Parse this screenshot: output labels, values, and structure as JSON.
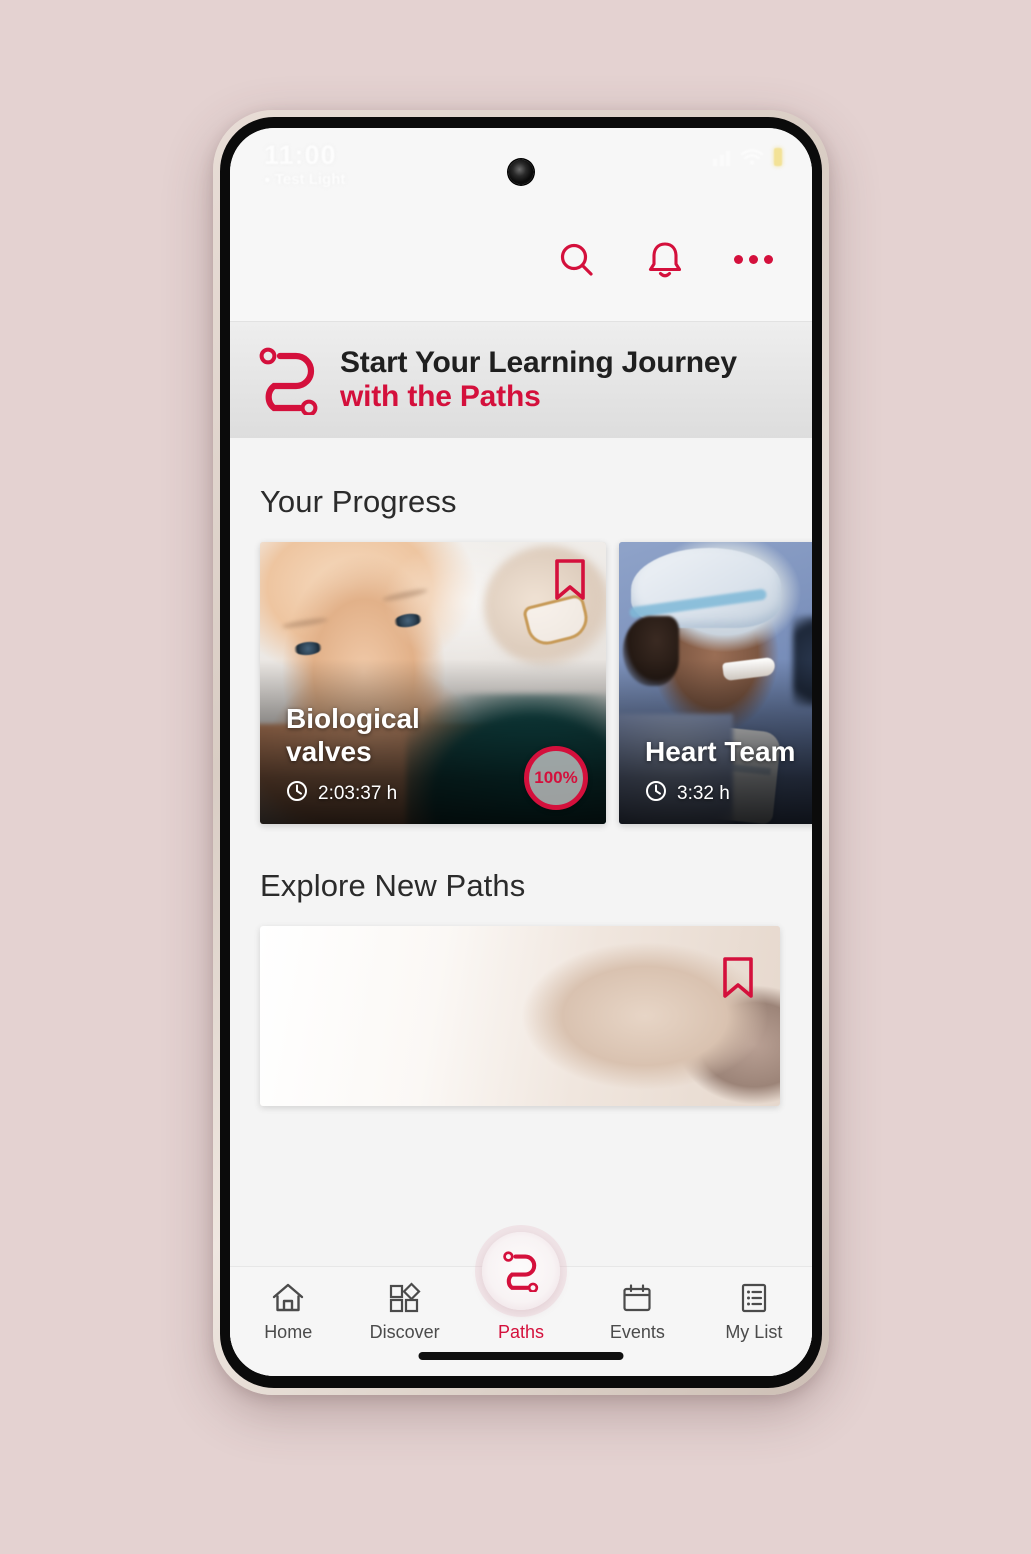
{
  "theme": {
    "accent": "#d4103c",
    "page_background": "#e4d2d1",
    "screen_background": "#f4f4f4",
    "header_background": "#f7f7f7",
    "banner_background": "#e6e6e6",
    "nav_label_color": "#4b4b4b",
    "battery_color": "#f0d24a"
  },
  "status_bar": {
    "time": "11:00",
    "carrier": "Test Light",
    "icons": {
      "signal": "signal-bars-icon",
      "wifi": "wifi-icon",
      "battery": "battery-icon",
      "camera": "front-camera-punch-hole"
    }
  },
  "app_header": {
    "actions": [
      {
        "name": "search-icon",
        "label": "Search"
      },
      {
        "name": "notifications-bell-icon",
        "label": "Notifications"
      },
      {
        "name": "more-options-icon",
        "label": "More options"
      }
    ]
  },
  "hero_banner": {
    "logo": "paths-route-logo",
    "line1": "Start Your Learning Journey",
    "line2": "with the Paths"
  },
  "sections": {
    "progress": {
      "title": "Your Progress",
      "cards": [
        {
          "title": "Biological\nvalves",
          "duration": "2:03:37 h",
          "progress": "100%",
          "bookmark": "bookmark-icon",
          "clock": "clock-icon",
          "image_alt": "smiling older woman"
        },
        {
          "title": "Heart Team",
          "duration": "3:32 h",
          "clock": "clock-icon",
          "image_alt": "surgeon in blue scrubs and cap"
        }
      ]
    },
    "explore": {
      "title": "Explore New Paths",
      "cards": [
        {
          "bookmark": "bookmark-icon",
          "image_alt": "clinical scene"
        }
      ]
    }
  },
  "bottom_nav": {
    "items": [
      {
        "label": "Home",
        "icon": "home-icon",
        "active": false
      },
      {
        "label": "Discover",
        "icon": "discover-icon",
        "active": false
      },
      {
        "label": "Paths",
        "icon": "paths-icon",
        "active": true
      },
      {
        "label": "Events",
        "icon": "calendar-icon",
        "active": false
      },
      {
        "label": "My List",
        "icon": "list-icon",
        "active": false
      }
    ],
    "fab": {
      "name": "paths-fab",
      "icon": "paths-route-logo"
    },
    "home_indicator": "gesture-home-bar"
  }
}
